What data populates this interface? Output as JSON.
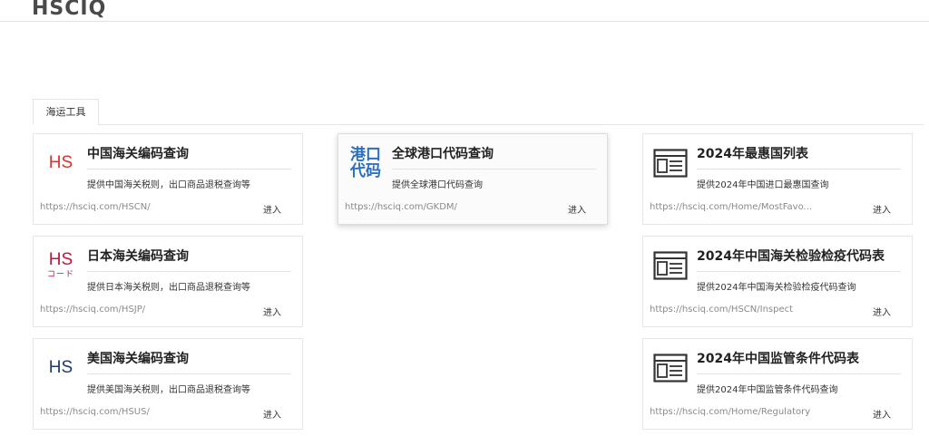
{
  "header": {
    "logo_text": "HSCIQ"
  },
  "tabs": [
    {
      "label": "海运工具"
    }
  ],
  "cards": {
    "hscn": {
      "title": "中国海关编码查询",
      "desc": "提供中国海关税则，出口商品退税查询等",
      "url": "https://hsciq.com/HSCN/",
      "enter": "进入",
      "icon": "HS"
    },
    "hsjp": {
      "title": "日本海关编码查询",
      "desc": "提供日本海关税则，出口商品退税查询等",
      "url": "https://hsciq.com/HSJP/",
      "enter": "进入",
      "icon": "HS",
      "icon_sub": "コード"
    },
    "hsus": {
      "title": "美国海关编码查询",
      "desc": "提供美国海关税则，出口商品退税查询等",
      "url": "https://hsciq.com/HSUS/",
      "enter": "进入",
      "icon": "HS"
    },
    "gkdm": {
      "title": "全球港口代码查询",
      "desc": "提供全球港口代码查询",
      "url": "https://hsciq.com/GKDM/",
      "enter": "进入",
      "icon_line1": "港口",
      "icon_line2": "代码"
    },
    "mfn": {
      "title": "2024年最惠国列表",
      "desc": "提供2024年中国进口最惠国查询",
      "url": "https://hsciq.com/Home/MostFavo...",
      "enter": "进入"
    },
    "inspect": {
      "title": "2024年中国海关检验检疫代码表",
      "desc": "提供2024年中国海关检验检疫代码查询",
      "url": "https://hsciq.com/HSCN/Inspect",
      "enter": "进入"
    },
    "regul": {
      "title": "2024年中国监管条件代码表",
      "desc": "提供2024年中国监管条件代码查询",
      "url": "https://hsciq.com/Home/Regulatory",
      "enter": "进入"
    }
  },
  "colors": {
    "hs_red": "#e0312c",
    "hs_crimson": "#c3163a",
    "hs_navy": "#1d3a6b",
    "port_blue": "#2a6fc2"
  }
}
